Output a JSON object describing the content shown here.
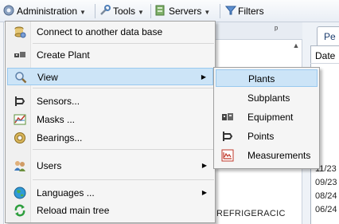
{
  "toolbar": {
    "administration": "Administration",
    "tools": "Tools",
    "servers": "Servers",
    "filters": "Filters"
  },
  "background": {
    "tab_label": "Pe",
    "date_header": "Date",
    "dates": [
      "11/23",
      "09/23",
      "08/24",
      "06/24"
    ],
    "tree_text": "REFRIGERACIC"
  },
  "menu": {
    "items": [
      {
        "label": "Connect to another data base",
        "icon": "database-connect-icon"
      },
      {
        "label": "Create Plant",
        "icon": "create-plant-icon"
      },
      {
        "label": "View",
        "icon": "magnifier-icon",
        "submenu": true,
        "highlighted": true
      },
      {
        "label": "Sensors...",
        "icon": "sensor-icon"
      },
      {
        "label": "Masks ...",
        "icon": "mask-icon"
      },
      {
        "label": "Bearings...",
        "icon": "bearing-icon"
      },
      {
        "label": "Users",
        "icon": "users-icon",
        "submenu": true
      },
      {
        "label": "Languages ...",
        "icon": "globe-icon",
        "submenu": true
      },
      {
        "label": "Reload main tree",
        "icon": "reload-icon"
      }
    ]
  },
  "submenu": {
    "items": [
      {
        "label": "Plants",
        "highlighted": true
      },
      {
        "label": "Subplants"
      },
      {
        "label": "Equipment",
        "icon": "equipment-icon"
      },
      {
        "label": "Points",
        "icon": "point-icon"
      },
      {
        "label": "Measurements",
        "icon": "measurement-chart-icon"
      }
    ]
  }
}
